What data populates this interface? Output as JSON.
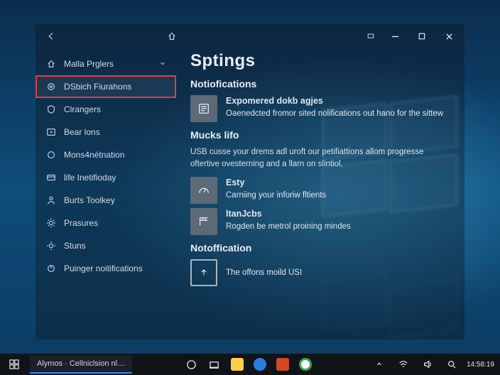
{
  "window": {
    "title": "Sptings",
    "section1_heading": "Notiofications",
    "tile1_title": "Expomered dokb agjes",
    "tile1_desc": "Oaenedcted fromor sited nolifications out hano for the sittew",
    "section2_heading": "Mucks lifo",
    "section2_desc": "USB cusse your drems adl uroft our petifiattions allom progresse oftertive ovesterning and a llarn on slintiol,",
    "tile2_title": "Esty",
    "tile2_desc": "Carniing your inforiw fltients",
    "tile3_title": "ltanJcbs",
    "tile3_desc": "Rogden be metrol proining mindes",
    "section3_heading": "Notoffication",
    "tile4_desc": "The offons moild USI"
  },
  "sidebar": {
    "items": [
      {
        "label": "Malla Prglers",
        "icon": "home-icon",
        "expandable": true
      },
      {
        "label": "DSbich Fiurahons",
        "icon": "target-icon",
        "selected": true
      },
      {
        "label": "Clrangers",
        "icon": "shield-icon"
      },
      {
        "label": "Bear lons",
        "icon": "play-icon"
      },
      {
        "label": "Mons4nétnation",
        "icon": "circle-icon"
      },
      {
        "label": "life Inetifioday",
        "icon": "card-icon"
      },
      {
        "label": "Burts Toolkey",
        "icon": "person-icon"
      },
      {
        "label": "Prasures",
        "icon": "gear-icon"
      },
      {
        "label": "Stuns",
        "icon": "gear-icon"
      },
      {
        "label": "Puinger noitifications",
        "icon": "power-icon"
      }
    ]
  },
  "taskbar": {
    "active_app": "Alymos · Cellniclsion nl…",
    "clock": "14:58:19"
  },
  "colors": {
    "highlight_border": "#e53b44",
    "accent": "#3a86ff"
  }
}
